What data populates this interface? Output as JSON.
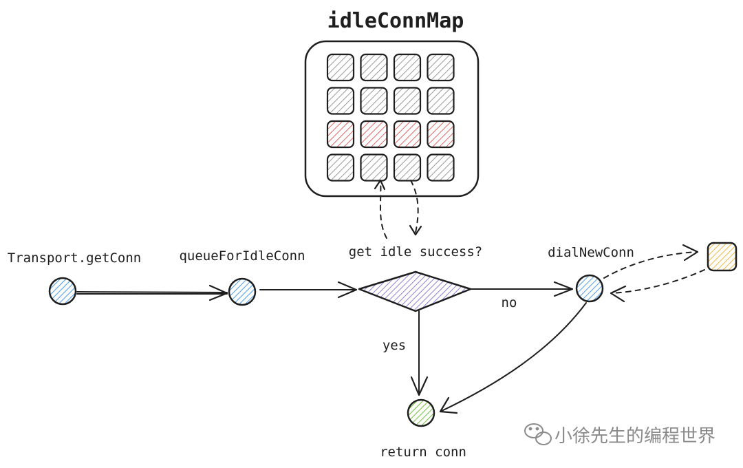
{
  "title": "idleConnMap",
  "nodes": {
    "get_conn": {
      "label": "Transport.getConn",
      "color": "#4a9be8"
    },
    "queue": {
      "label": "queueForIdleConn",
      "color": "#4a9be8"
    },
    "decision": {
      "label": "get idle success?",
      "color": "#8b7fd6"
    },
    "dial": {
      "label": "dialNewConn",
      "color": "#4a9be8"
    },
    "return": {
      "label": "return conn",
      "color": "#6fbf3a"
    },
    "new_conn": {
      "color": "#f2b84b"
    }
  },
  "edges": {
    "no": "no",
    "yes": "yes"
  },
  "grid": {
    "rows": [
      [
        "gray",
        "gray",
        "gray",
        "gray"
      ],
      [
        "gray",
        "gray",
        "gray",
        "gray"
      ],
      [
        "red",
        "red",
        "red",
        "red"
      ],
      [
        "gray",
        "gray",
        "gray",
        "gray"
      ]
    ],
    "colors": {
      "gray": "#9a9a9a",
      "red": "#e06666"
    }
  },
  "watermark": "小徐先生的编程世界"
}
